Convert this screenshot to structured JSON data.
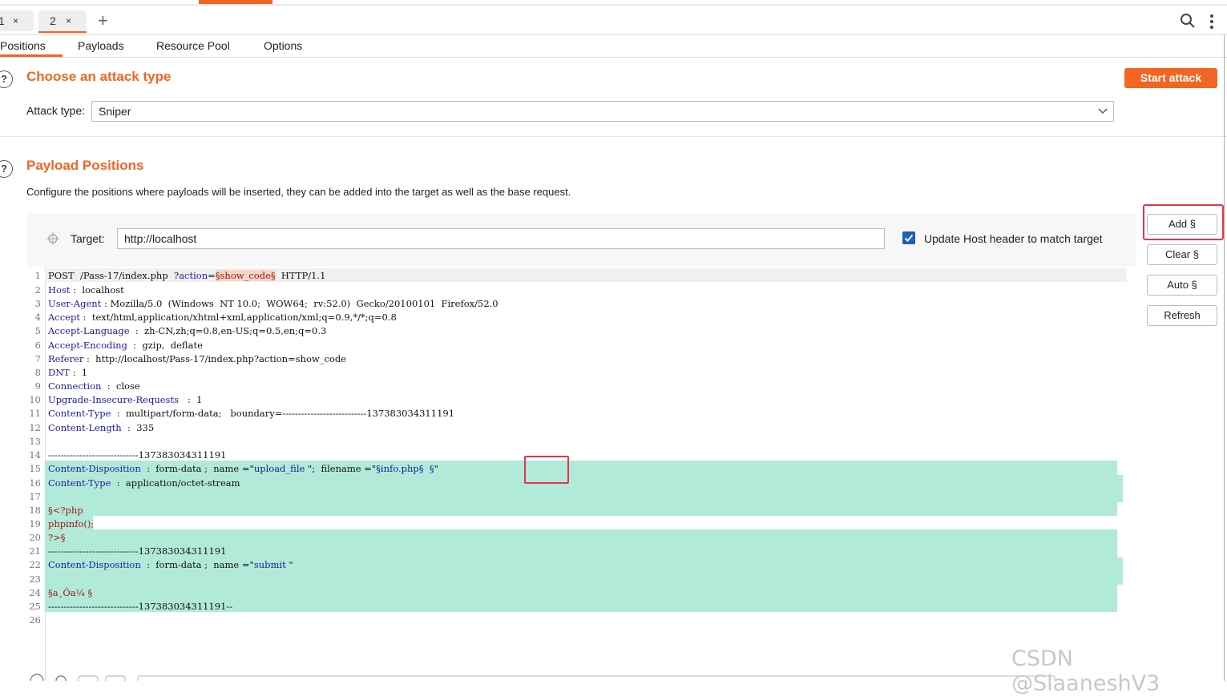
{
  "tabs": [
    {
      "label": "1",
      "close": "×"
    },
    {
      "label": "2",
      "close": "×"
    }
  ],
  "new_tab": "+",
  "icons": {
    "search": "search-icon",
    "menu": "kebab-menu-icon",
    "help": "help-icon",
    "target": "crosshair-icon",
    "chevron": "chevron-down-icon"
  },
  "subtabs": [
    "Positions",
    "Payloads",
    "Resource Pool",
    "Options"
  ],
  "attack": {
    "help": "?",
    "title": "Choose an attack type",
    "start_label": "Start attack",
    "type_label": "Attack type:",
    "type_value": "Sniper"
  },
  "positions": {
    "help": "?",
    "title": "Payload Positions",
    "description": "Configure the positions where payloads will be inserted, they can be added into the target as well as the base request.",
    "target_label": "Target:",
    "target_value": "http://localhost",
    "update_host_label": "Update Host header to match target",
    "update_host_checked": true
  },
  "buttons": {
    "add": "Add §",
    "clear": "Clear §",
    "auto": "Auto §",
    "refresh": "Refresh"
  },
  "request_lines": {
    "l1": {
      "a": "POST  /Pass-17/index.php  ?",
      "b": "action",
      "c": "=",
      "d": "§show_code§",
      "e": "  HTTP/1.1"
    },
    "l2": {
      "k": "Host",
      "v": " :  localhost"
    },
    "l3": {
      "k": "User-Agent",
      "v": " : Mozilla/5.0  (Windows  NT 10.0;  WOW64;  rv:52.0)  Gecko/20100101  Firefox/52.0"
    },
    "l4": {
      "k": "Accept",
      "v": " :  text/html,application/xhtml+xml,application/xml;q=0.9,*/*;q=0.8"
    },
    "l5": {
      "k": "Accept-Language",
      "v": "  :  zh-CN,zh;q=0.8,en-US;q=0.5,en;q=0.3"
    },
    "l6": {
      "k": "Accept-Encoding",
      "v": "  :  gzip,  deflate"
    },
    "l7": {
      "k": "Referer",
      "v": " :  http://localhost/Pass-17/index.php?action=show_code"
    },
    "l8": {
      "k": "DNT",
      "v": " :  1"
    },
    "l9": {
      "k": "Connection",
      "v": "  :  close"
    },
    "l10": {
      "k": "Upgrade-Insecure-Requests",
      "v": "   :  1"
    },
    "l11": {
      "k": "Content-Type",
      "v": "  :  multipart/form-data;   boundary=---------------------------137383034311191"
    },
    "l12": {
      "k": "Content-Length",
      "v": "  :  335"
    },
    "l14": "-----------------------------137383034311191",
    "l15": {
      "k": "Content-Disposition",
      "a": "  :  form-data ;  name =\"",
      "b": "upload_file",
      "c": " \";  filename =\"",
      "d": "§info.php§  §",
      "e": "\""
    },
    "l16": {
      "k": "Content-Type",
      "v": "  :  application/octet-stream"
    },
    "l18": "§<?php",
    "l19": "phpinfo();",
    "l20": "?>§",
    "l21": "-----------------------------137383034311191",
    "l22": {
      "k": "Content-Disposition",
      "a": "  :  form-data ;  name =\"",
      "b": "submit",
      "c": " \""
    },
    "l24": "§a¸Ôa¼ §",
    "l25": "-----------------------------137383034311191--"
  },
  "line_numbers": [
    "1",
    "2",
    "3",
    "4",
    "5",
    "6",
    "7",
    "8",
    "9",
    "10",
    "11",
    "12",
    "13",
    "14",
    "15",
    "16",
    "17",
    "18",
    "19",
    "20",
    "21",
    "22",
    "23",
    "24",
    "25",
    "26"
  ],
  "watermark": "CSDN @SlaaneshV3",
  "colors": {
    "accent": "#f26522",
    "highlight": "#b2ead9",
    "keyword": "#1a1aa6",
    "payload": "#a31515",
    "annotation": "#e8334a"
  }
}
